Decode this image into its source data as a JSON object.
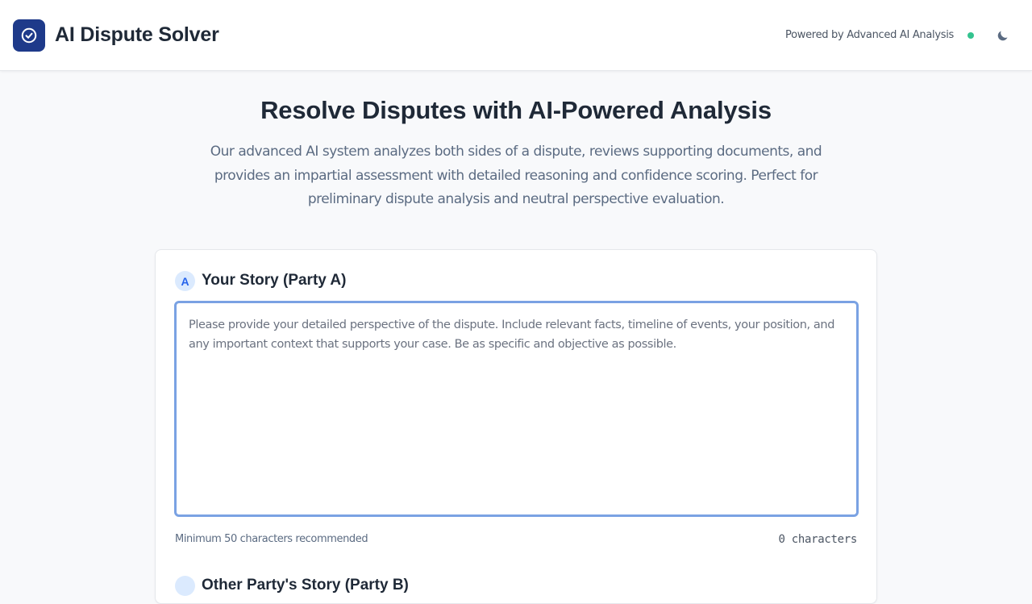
{
  "header": {
    "app_title": "AI Dispute Solver",
    "logo_icon": "check-circle-icon",
    "powered_by": "Powered by Advanced AI Analysis",
    "status_color": "#34c38f",
    "theme_toggle_icon": "moon-icon"
  },
  "hero": {
    "title": "Resolve Disputes with AI-Powered Analysis",
    "description": "Our advanced AI system analyzes both sides of a dispute, reviews supporting documents, and provides an impartial assessment with detailed reasoning and confidence scoring. Perfect for preliminary dispute analysis and neutral perspective evaluation."
  },
  "party_a": {
    "badge": "A",
    "title": "Your Story (Party A)",
    "value": "",
    "placeholder": "Please provide your detailed perspective of the dispute. Include relevant facts, timeline of events, your position, and any important context that supports your case. Be as specific and objective as possible.",
    "hint": "Minimum 50 characters recommended",
    "char_count": "0 characters"
  },
  "party_b": {
    "title": "Other Party's Story (Party B)"
  },
  "colors": {
    "brand": "#1e3a8a",
    "accent": "#2563eb",
    "focus_border": "#7aa2e3"
  }
}
